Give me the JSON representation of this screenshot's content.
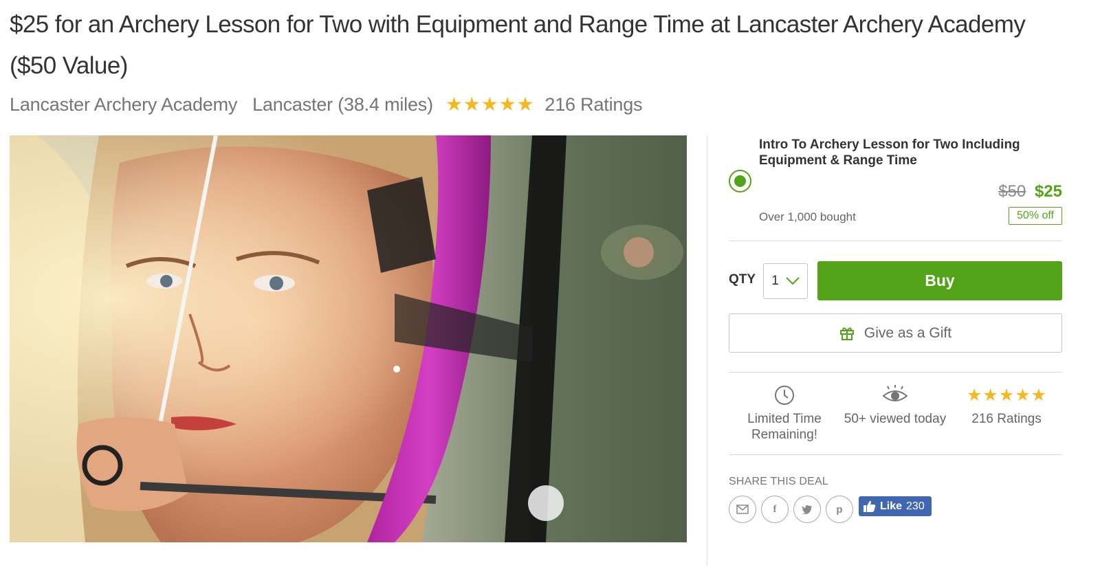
{
  "deal": {
    "title": "$25 for an Archery Lesson for Two with Equipment and Range Time at Lancaster Archery Academy ($50 Value)",
    "merchant": "Lancaster Archery Academy",
    "location": "Lancaster (38.4 miles)",
    "rating": 5,
    "ratings_count_label": "216 Ratings"
  },
  "hero": {
    "alt": "archer-photo"
  },
  "option": {
    "title": "Intro To Archery Lesson for Two Including Equipment & Range Time",
    "original_price": "$50",
    "price": "$25",
    "discount": "50% off",
    "bought": "Over 1,000 bought",
    "selected": true
  },
  "purchase": {
    "qty_label": "QTY",
    "qty_value": "1",
    "buy_label": "Buy",
    "gift_label": "Give as a Gift"
  },
  "features": {
    "time_label": "Limited Time Remaining!",
    "viewed_label": "50+ viewed today",
    "ratings_label": "216 Ratings",
    "rating": 5
  },
  "share": {
    "label": "SHARE THIS DEAL",
    "icons": [
      "email-icon",
      "facebook-icon",
      "twitter-icon",
      "pinterest-icon"
    ],
    "like_label": "Like",
    "like_count": "230"
  },
  "colors": {
    "brand_green": "#53a318",
    "star_gold": "#f5b820",
    "facebook_blue": "#4267b2"
  }
}
